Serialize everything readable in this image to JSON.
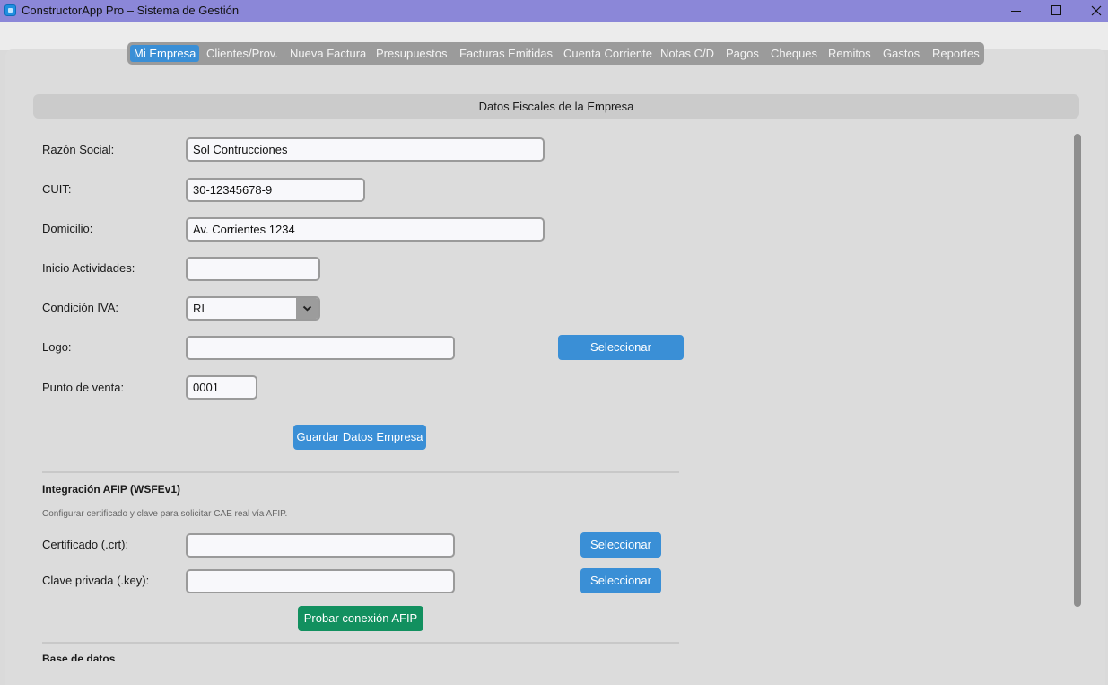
{
  "window": {
    "title": "ConstructorApp Pro – Sistema de Gestión"
  },
  "tabs": [
    {
      "label": "Mi Empresa",
      "active": true
    },
    {
      "label": "Clientes/Prov."
    },
    {
      "label": "Nueva Factura"
    },
    {
      "label": "Presupuestos"
    },
    {
      "label": "Facturas Emitidas"
    },
    {
      "label": "Cuenta Corriente"
    },
    {
      "label": "Notas C/D"
    },
    {
      "label": "Pagos"
    },
    {
      "label": "Cheques"
    },
    {
      "label": "Remitos"
    },
    {
      "label": "Gastos"
    },
    {
      "label": "Reportes"
    }
  ],
  "section": {
    "title": "Datos Fiscales de la Empresa"
  },
  "form": {
    "razon_social": {
      "label": "Razón Social:",
      "value": "Sol Contrucciones"
    },
    "cuit": {
      "label": "CUIT:",
      "value": "30-12345678-9"
    },
    "domicilio": {
      "label": "Domicilio:",
      "value": "Av. Corrientes 1234"
    },
    "inicio": {
      "label": "Inicio Actividades:",
      "value": ""
    },
    "condicion_iva": {
      "label": "Condición IVA:",
      "value": "RI"
    },
    "logo": {
      "label": "Logo:",
      "value": "",
      "button": "Seleccionar"
    },
    "punto_venta": {
      "label": "Punto de venta:",
      "value": "0001"
    },
    "save_button": "Guardar Datos Empresa"
  },
  "afip": {
    "title": "Integración AFIP (WSFEv1)",
    "note": "Configurar certificado y clave para solicitar CAE real vía AFIP.",
    "cert": {
      "label": "Certificado (.crt):",
      "value": "",
      "button": "Seleccionar"
    },
    "key": {
      "label": "Clave privada (.key):",
      "value": "",
      "button": "Seleccionar"
    },
    "test_button": "Probar conexión AFIP"
  },
  "db": {
    "title": "Base de datos"
  },
  "colors": {
    "accent": "#3a8fd6",
    "success": "#12905f",
    "titlebar": "#8b87d8"
  }
}
